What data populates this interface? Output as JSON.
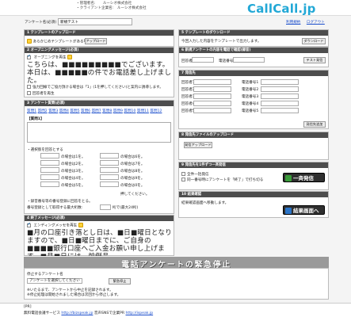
{
  "header": {
    "info_line1": "・管理者名:　　ルーシオ株式会社",
    "info_line2": "・クライアント企業名:　ルーシオ株式会社",
    "logo": "CallCall.jp"
  },
  "title_row": {
    "label": "アンケート名(必須)",
    "value": "新規テスト",
    "links": [
      "利用規約",
      "ログアウト"
    ]
  },
  "left": {
    "p1": {
      "heading": "1 テンプレートのアップロード",
      "text": "あらかじめテンプレートがある場合は",
      "button": "アップロード"
    },
    "p2": {
      "heading": "2 オープニングメッセージ(必須)",
      "check_label": "オープニングを再生",
      "big_text_1": "こちらは、■■■■■■■■■でございます。本日は、■■■■■の件でお電話差し上げました。",
      "big_text_2": "",
      "opt1": "強力回線でご協力頂ける場合は「1」(1を押してください)と案内に誘導します。",
      "opt2": "回答者を再生"
    },
    "p3": {
      "heading": "3 アンケート質問(必須)",
      "q_links": [
        "質問1",
        "質問2",
        "質問3",
        "質問4",
        "質問5",
        "質問6",
        "質問7",
        "質問8",
        "質問9",
        "質問10",
        "質問11",
        "質問12"
      ],
      "q_label": "【質問1】",
      "select_label": "・選択肢を回答とする",
      "rows": [
        {
          "a": "の場合は1を。",
          "b": "の場合は6を。"
        },
        {
          "a": "の場合は2を。",
          "b": "の場合は7を。"
        },
        {
          "a": "の場合は3を。",
          "b": "の場合は8を。"
        },
        {
          "a": "の場合は4を。",
          "b": "の場合は9を。"
        },
        {
          "a": "の場合は5を。",
          "b": "の場合は0を。"
        }
      ],
      "push_label": "押してください。",
      "voice_label": "・録音番号等の番号登録に回答をとる。",
      "digits_label": "番号登録として取得する最大桁数:",
      "digits_value": "桁で(最大24桁)"
    },
    "p4": {
      "heading": "4 終了メッセージ(必須)",
      "check_label": "エンディングメッセを再生",
      "big_text": "■月の口座引き落とし日は、■日■曜日となりますので、■日■曜日までに、ご自身の■■■■銀行口座へご入金お願い申し上げます。■月■日には、前例品"
    }
  },
  "right": {
    "r1": {
      "heading": "5 テンプレートのダウンロード",
      "text": "今回入力した内容をテンプレートで出力します。",
      "button": "ダウンロード"
    },
    "r2": {
      "heading": "6 新規アンケートの内容を電話で確認(録音)",
      "label_a": "回答者",
      "label_b": "電話番号",
      "button": "テスト発信"
    },
    "r3": {
      "heading": "7 発信先",
      "left_labels": [
        "回答者1",
        "回答者2",
        "回答者3",
        "回答者4",
        "回答者5"
      ],
      "right_labels": [
        "電話番号1",
        "電話番号2",
        "電話番号3",
        "電話番号4",
        "電話番号5"
      ],
      "button": "発信先追加"
    },
    "r4": {
      "heading": "8 発信先ファイルのアップロード",
      "button": "発信アップロード"
    },
    "r5": {
      "heading": "9 発信先を1件ずつ一斉発信",
      "opt1": "全件一括発信",
      "opt2": "同一番号時にアンケートを「終了」で打ち切る",
      "call_button": "一斉発信"
    },
    "r6": {
      "heading": "10 結果確認",
      "text": "結果確認画面へ移動します。",
      "result_button": "結果画面へ"
    }
  },
  "banner": {
    "text": "電話アンケートの緊急停止"
  },
  "stop": {
    "label": "停止するアンケート名",
    "select_value": "アンケートを選択してください",
    "button": "緊急停止",
    "note1": "※いたるまで、アンケートから中止を記録されます。",
    "note2": "※停止処理は開始されました場合は次回から停止します。"
  },
  "footer": {
    "pr": "[PR]",
    "line2_prefix": "無料電話会議サービス",
    "line2_link1": "http://bizspeak.jp",
    "line2_mid": "音声SNSで企業PR",
    "line2_link2": "http://ispeak.jp"
  }
}
